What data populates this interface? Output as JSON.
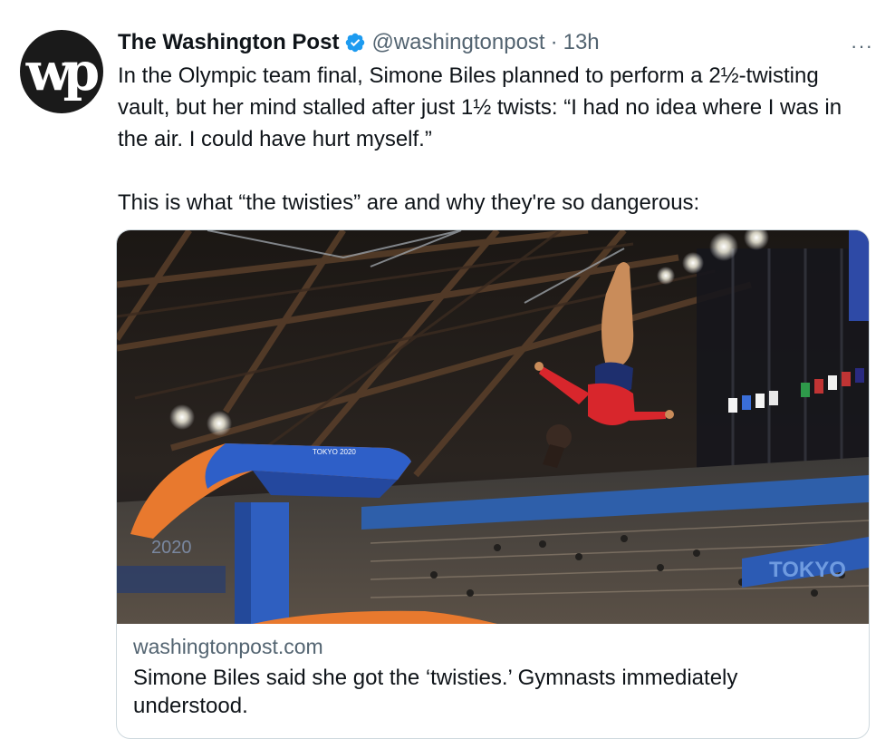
{
  "author": {
    "name": "The Washington Post",
    "handle": "@washingtonpost",
    "separator": "·",
    "time": "13h",
    "avatar_text": "wp"
  },
  "more_label": "···",
  "tweet": {
    "paragraphs": [
      "In the Olympic team final, Simone Biles planned to perform a 2½-twisting vault, but her mind stalled after just 1½ twists: “I had no idea where I was in the air. I could have hurt myself.”",
      "This is what “the twisties” are and why they're so dangerous:"
    ]
  },
  "card": {
    "domain": "washingtonpost.com",
    "title": "Simone Biles said she got the ‘twisties.’ Gymnasts immediately understood.",
    "image_signage": {
      "vault_label": "TOKYO 2020",
      "arena_banner": "TOKYO",
      "stand_text": "2020"
    }
  },
  "colors": {
    "verified_blue": "#1d9bf0",
    "secondary_text": "#536471",
    "text": "#0f1419",
    "card_border": "#cfd9de"
  },
  "icons": {
    "verified": "verified-badge-icon",
    "more": "more-options-icon"
  }
}
